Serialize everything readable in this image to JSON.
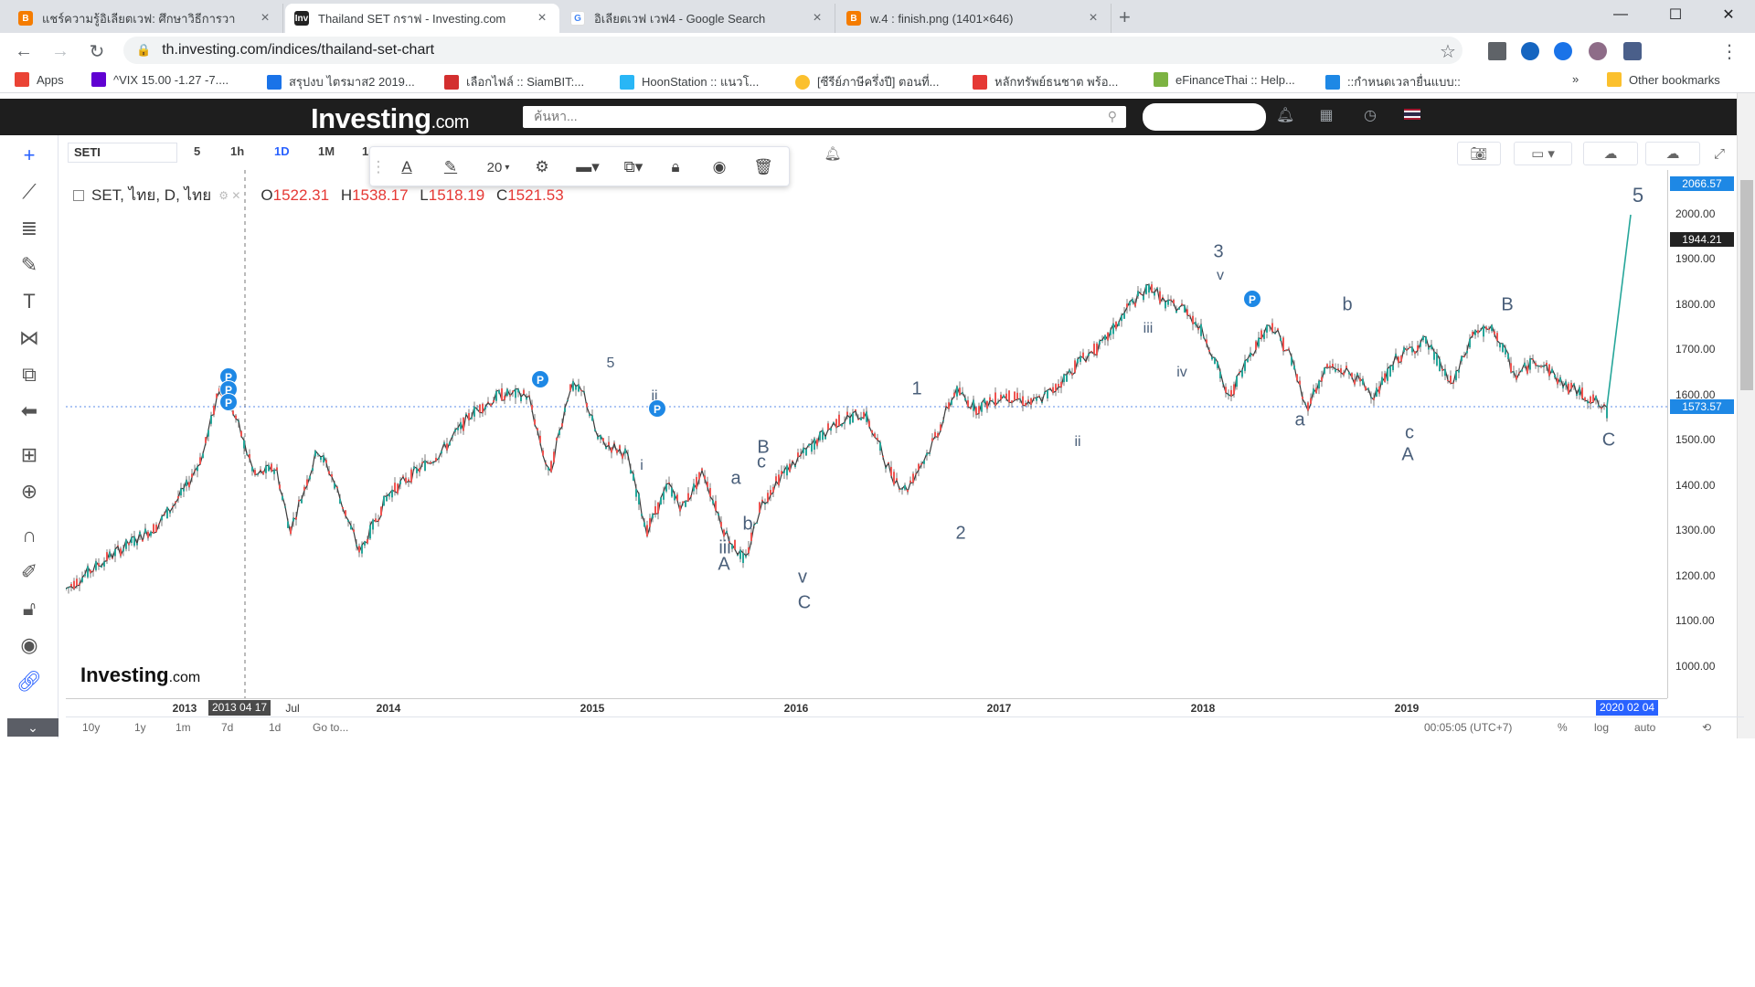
{
  "browser": {
    "tabs": [
      {
        "title": "แชร์ความรู้อิเลียตเวฟ: ศึกษาวิธีการวา",
        "active": false,
        "fav": "blogger"
      },
      {
        "title": "Thailand SET กราฟ - Investing.com",
        "active": true,
        "fav": "investing"
      },
      {
        "title": "อิเลียตเวฟ เวฟ4 - Google Search",
        "active": false,
        "fav": "google"
      },
      {
        "title": "w.4 : finish.png (1401×646)",
        "active": false,
        "fav": "blogger"
      }
    ],
    "url": "th.investing.com/indices/thailand-set-chart",
    "bookmarks": [
      {
        "label": "Apps",
        "color": "#ea4335"
      },
      {
        "label": "^VIX 15.00 -1.27 -7....",
        "color": "#6001d2"
      },
      {
        "label": "สรุปงบ ไตรมาส2 2019...",
        "color": "#1a73e8"
      },
      {
        "label": "เลือกไฟล์ :: SiamBIT:...",
        "color": "#d32f2f"
      },
      {
        "label": "HoonStation :: แนวโ...",
        "color": "#29b6f6"
      },
      {
        "label": "[ซีรีย์ภาษีครึ่งปี] ตอนที่...",
        "color": "#fbc02d"
      },
      {
        "label": "หลักทรัพย์ธนชาต พร้อ...",
        "color": "#e53935"
      },
      {
        "label": "eFinanceThai :: Help...",
        "color": "#7cb342"
      },
      {
        "label": "::กำหนดเวลายื่นแบบ::",
        "color": "#1e88e5"
      }
    ],
    "bookmarks_overflow": "»",
    "other_bookmarks": "Other bookmarks"
  },
  "site": {
    "logo": "Investing",
    "logo_suffix": ".com",
    "search_placeholder": "ค้นหา..."
  },
  "chart": {
    "symbol": "SETI",
    "timeframes": [
      "5",
      "1h",
      "1D",
      "1M",
      "1"
    ],
    "active_timeframe": "1D",
    "legend_title": "SET, ไทย, D, ไทย",
    "ohlc": {
      "o": "O",
      "o_val": "1522.31",
      "h": "H",
      "h_val": "1538.17",
      "l": "L",
      "l_val": "1518.19",
      "c": "C",
      "c_val": "1521.53"
    },
    "font_size_value": "20",
    "watermark": "Investing",
    "watermark_suffix": ".com",
    "y_ticks": [
      "2000.00",
      "1900.00",
      "1800.00",
      "1700.00",
      "1600.00",
      "1500.00",
      "1400.00",
      "1300.00",
      "1200.00",
      "1100.00",
      "1000.00"
    ],
    "x_ticks": [
      "2013",
      "2014",
      "2015",
      "2016",
      "2017",
      "2018",
      "2019"
    ],
    "x_partial": "Jul",
    "crosshair_date": "2013 04 17",
    "last_date": "2020 02 04",
    "price_tags": [
      {
        "value": "2066.57",
        "color": "#1e88e5"
      },
      {
        "value": "1944.21",
        "color": "#222222"
      },
      {
        "value": "1573.57",
        "color": "#1e88e5"
      }
    ],
    "bottom_ranges": [
      "10y",
      "1y",
      "1m",
      "7d",
      "1d",
      "Go to..."
    ],
    "clock": "00:05:05 (UTC+7)",
    "bottom_right": [
      "%",
      "log",
      "auto"
    ],
    "wave_labels": [
      {
        "text": "5",
        "cls": "small"
      },
      {
        "text": "ii",
        "cls": "small"
      },
      {
        "text": "i",
        "cls": "small"
      },
      {
        "text": "a",
        "cls": ""
      },
      {
        "text": "B",
        "cls": ""
      },
      {
        "text": "c",
        "cls": ""
      },
      {
        "text": "b",
        "cls": ""
      },
      {
        "text": "iii",
        "cls": ""
      },
      {
        "text": "A",
        "cls": ""
      },
      {
        "text": "v",
        "cls": ""
      },
      {
        "text": "C",
        "cls": ""
      },
      {
        "text": "1",
        "cls": ""
      },
      {
        "text": "2",
        "cls": ""
      },
      {
        "text": "ii",
        "cls": "small"
      },
      {
        "text": "iii",
        "cls": "small"
      },
      {
        "text": "iv",
        "cls": "small"
      },
      {
        "text": "3",
        "cls": ""
      },
      {
        "text": "v",
        "cls": "small"
      },
      {
        "text": "a",
        "cls": ""
      },
      {
        "text": "b",
        "cls": ""
      },
      {
        "text": "c",
        "cls": ""
      },
      {
        "text": "A",
        "cls": ""
      },
      {
        "text": "B",
        "cls": ""
      },
      {
        "text": "C",
        "cls": ""
      },
      {
        "text": "5",
        "cls": "big"
      }
    ],
    "pmarks": [
      "P",
      "P",
      "P",
      "P",
      "P",
      "P"
    ]
  }
}
